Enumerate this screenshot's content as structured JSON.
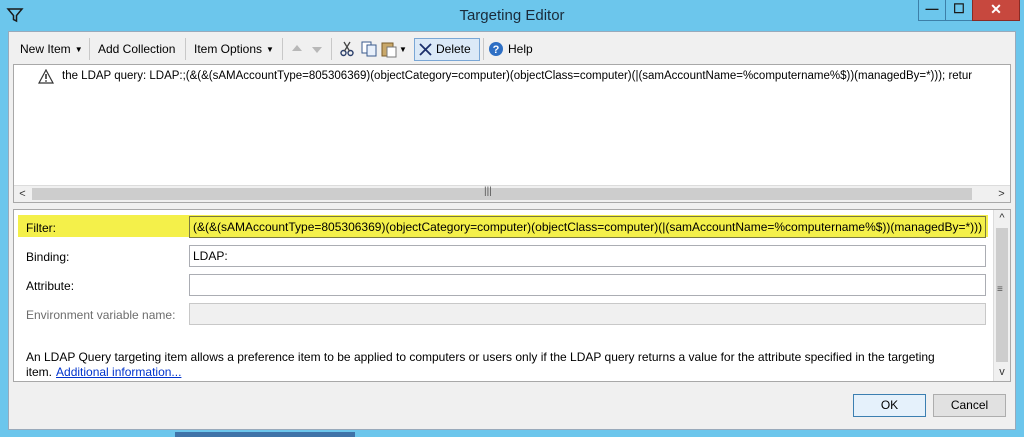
{
  "window": {
    "title": "Targeting Editor",
    "minimize_glyph": "—",
    "maximize_glyph": "☐",
    "close_glyph": "✕"
  },
  "toolbar": {
    "new_item": "New Item",
    "add_collection": "Add Collection",
    "item_options": "Item Options",
    "delete": "Delete",
    "help": "Help",
    "icons": [
      "move-up-icon",
      "move-down-icon",
      "cut-icon",
      "copy-icon",
      "paste-icon",
      "delete-icon",
      "help-icon"
    ]
  },
  "tree": {
    "item_text": "the LDAP query: LDAP:;(&(&(sAMAccountType=805306369)(objectCategory=computer)(objectClass=computer)(|(samAccountName=%computername%$))(managedBy=*))); retur"
  },
  "properties": {
    "filter": {
      "label": "Filter:",
      "value": "(&(&(sAMAccountType=805306369)(objectCategory=computer)(objectClass=computer)(|(samAccountName=%computername%$))(managedBy=*)))"
    },
    "binding": {
      "label": "Binding:",
      "value": "LDAP:"
    },
    "attribute": {
      "label": "Attribute:",
      "value": ""
    },
    "env_var": {
      "label": "Environment variable name:",
      "value": ""
    },
    "description": "An LDAP Query targeting item allows a preference item to be applied to computers or users only if the LDAP query returns a value for the attribute specified in the targeting item.",
    "link": "Additional information..."
  },
  "buttons": {
    "ok": "OK",
    "cancel": "Cancel"
  },
  "colors": {
    "titlebar": "#6cc6ec",
    "close": "#c7483e",
    "highlight": "#f4f04a",
    "link": "#0033cc"
  }
}
